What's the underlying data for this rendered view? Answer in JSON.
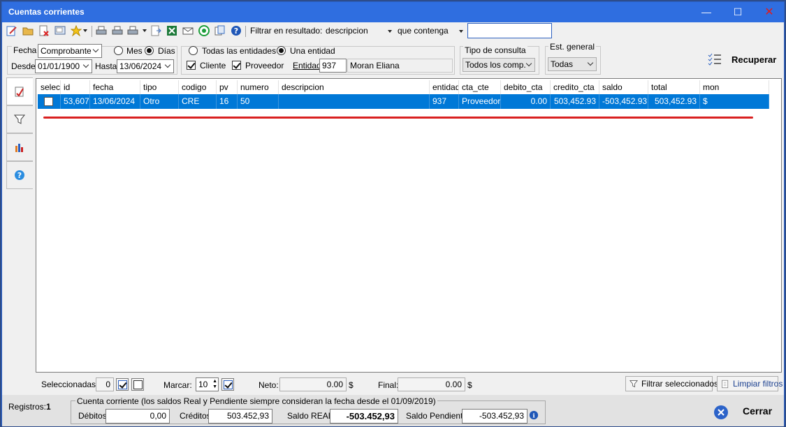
{
  "window": {
    "title": "Cuentas corrientes"
  },
  "toolbar": {
    "filter_label": "Filtrar en resultado:",
    "field_value": "descripcion",
    "condition_value": "que contenga",
    "search_value": ""
  },
  "filters": {
    "fecha_label": "Fecha",
    "fecha_type": "Comprobante",
    "mes_label": "Mes",
    "dias_label": "Días",
    "desde_label": "Desde",
    "desde_value": "01/01/1900",
    "hasta_label": "Hasta",
    "hasta_value": "13/06/2024",
    "todas_label": "Todas las entidades",
    "una_label": "Una entidad",
    "cliente_label": "Cliente",
    "proveedor_label": "Proveedor",
    "entidad_label": "Entidad",
    "entidad_id": "937",
    "entidad_name": "Moran Eliana",
    "tipo_consulta_label": "Tipo de consulta",
    "tipo_consulta_value": "Todos los comp.",
    "est_general_label": "Est. general",
    "est_general_value": "Todas",
    "recuperar_label": "Recuperar"
  },
  "grid": {
    "columns": [
      "selec",
      "id",
      "fecha",
      "tipo",
      "codigo",
      "pv",
      "numero",
      "descripcion",
      "entidad",
      "cta_cte",
      "debito_cta",
      "credito_cta",
      "saldo",
      "total",
      "mon"
    ],
    "rows": [
      [
        "",
        "53,607",
        "13/06/2024",
        "Otro",
        "CRE",
        "16",
        "50",
        "",
        "937",
        "Proveedor",
        "0.00",
        "503,452.93",
        "-503,452.93",
        "503,452.93",
        "$"
      ]
    ]
  },
  "bottom": {
    "seleccionadas_label": "Seleccionadas:",
    "seleccionadas_value": "0",
    "marcar_label": "Marcar:",
    "marcar_value": "10",
    "neto_label": "Neto:",
    "neto_value": "0.00",
    "neto_currency": "$",
    "final_label": "Final:",
    "final_value": "0.00",
    "final_currency": "$",
    "filtrar_sel_label": "Filtrar seleccionados",
    "limpiar_label": "Limpiar filtros"
  },
  "status": {
    "registros_label": "Registros:",
    "registros_value": "1",
    "cc_note": "Cuenta corriente (los saldos Real y Pendiente siempre consideran la fecha desde el 01/09/2019)",
    "debitos_label": "Débitos",
    "debitos_value": "0,00",
    "creditos_label": "Créditos",
    "creditos_value": "503.452,93",
    "saldo_real_label": "Saldo REAL",
    "saldo_real_value": "-503.452,93",
    "saldo_pend_label": "Saldo Pendiente",
    "saldo_pend_value": "-503.452,93",
    "cerrar_label": "Cerrar"
  },
  "colors": {
    "titlebar": "#2f6ee0",
    "selection": "#0078d7",
    "accent_red": "#d92020"
  }
}
